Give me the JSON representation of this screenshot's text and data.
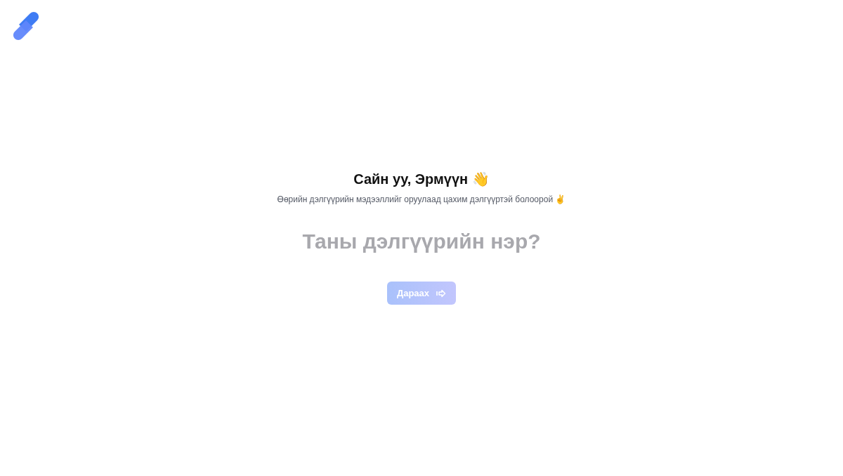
{
  "greeting": {
    "title": "Сайн уу, Эрмүүн 👋",
    "subtitle": "Өөрийн дэлгүүрийн мэдээллийг оруулаад цахим дэлгүүртэй болоорой ✌️"
  },
  "store_name": {
    "placeholder": "Таны дэлгүүрийн нэр?"
  },
  "next_button": {
    "label": "Дараах",
    "disabled": true
  }
}
